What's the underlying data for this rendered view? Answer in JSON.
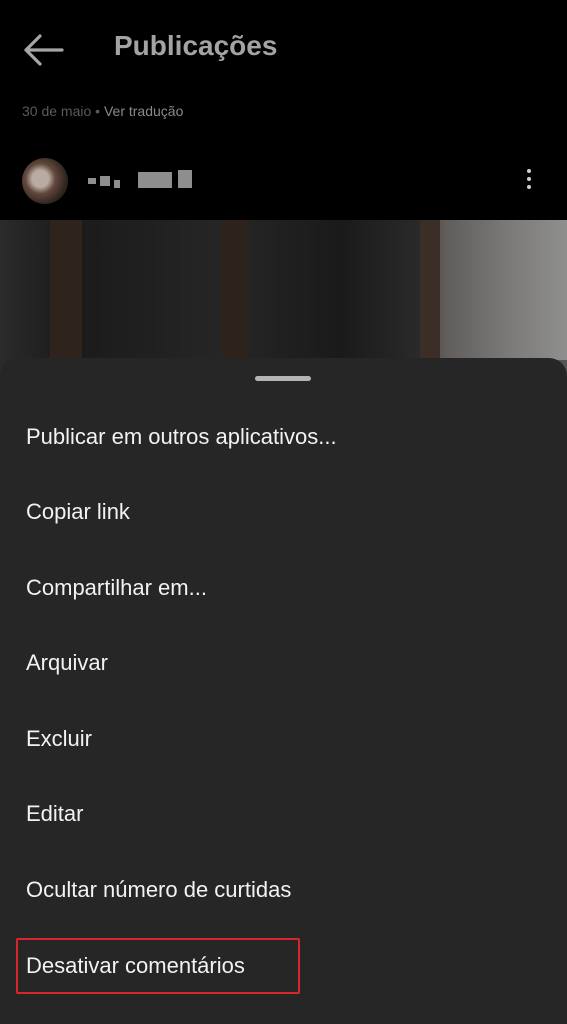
{
  "header": {
    "title": "Publicações",
    "date": "30 de maio",
    "separator": "•",
    "translate_link": "Ver tradução"
  },
  "icons": {
    "back": "back-arrow-icon",
    "more": "more-vertical-icon"
  },
  "colors": {
    "sheet_background": "#262626",
    "highlight_border": "#d9262c"
  },
  "menu": {
    "items": [
      {
        "label": "Publicar em outros aplicativos..."
      },
      {
        "label": "Copiar link"
      },
      {
        "label": "Compartilhar em..."
      },
      {
        "label": "Arquivar"
      },
      {
        "label": "Excluir"
      },
      {
        "label": "Editar"
      },
      {
        "label": "Ocultar número de curtidas"
      },
      {
        "label": "Desativar comentários"
      }
    ],
    "highlighted_item": "Desativar comentários"
  }
}
